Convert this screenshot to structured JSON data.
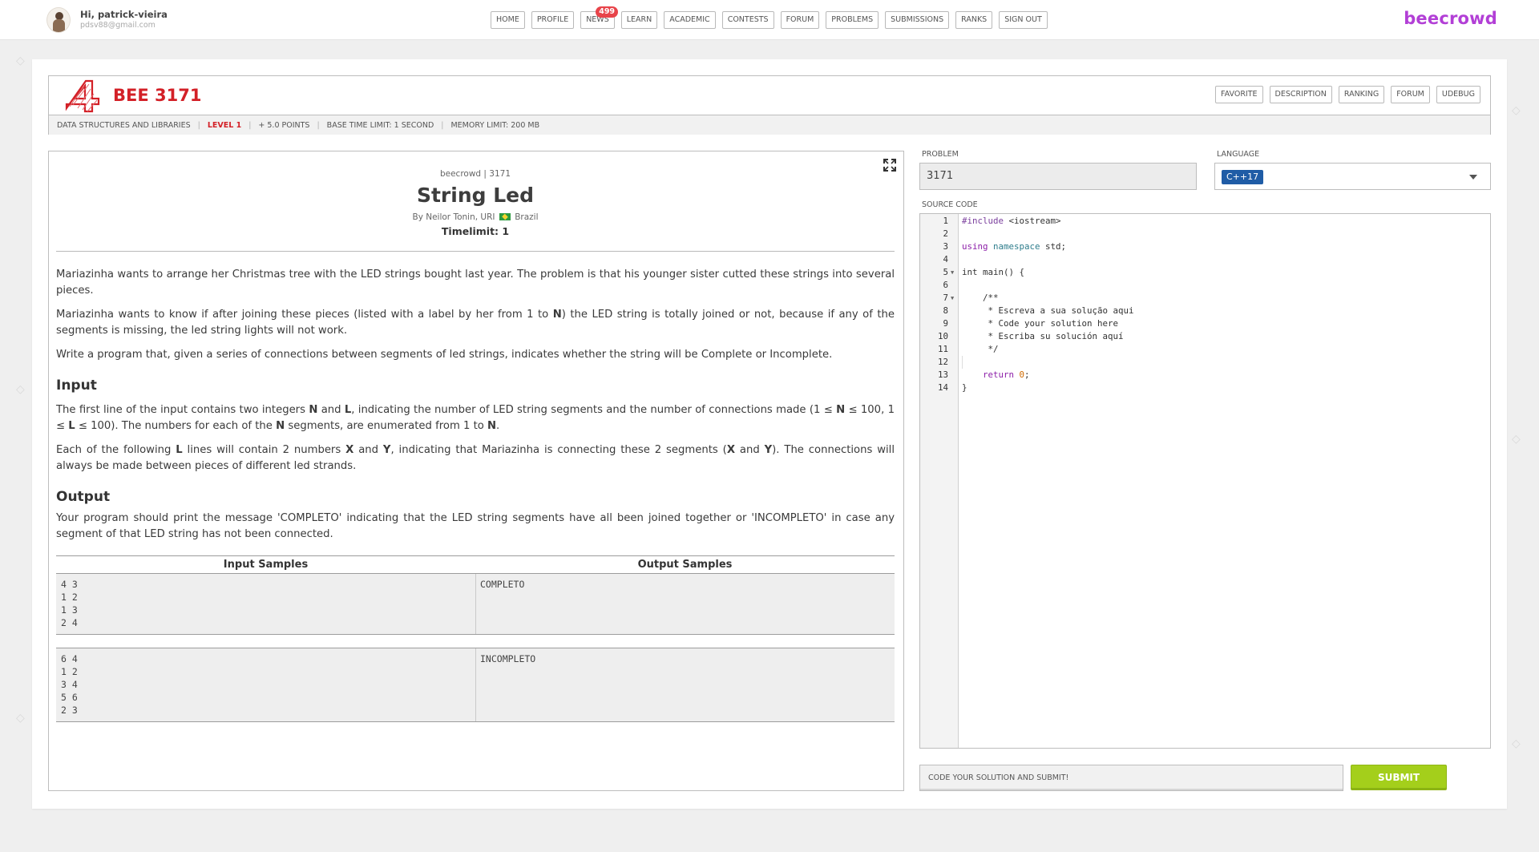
{
  "user": {
    "greeting_prefix": "Hi,",
    "name": "patrick-vieira",
    "email": "pdsv88@gmail.com"
  },
  "nav": [
    {
      "label": "HOME"
    },
    {
      "label": "PROFILE"
    },
    {
      "label": "NEWS",
      "badge": "499"
    },
    {
      "label": "LEARN"
    },
    {
      "label": "ACADEMIC"
    },
    {
      "label": "CONTESTS"
    },
    {
      "label": "FORUM"
    },
    {
      "label": "PROBLEMS"
    },
    {
      "label": "SUBMISSIONS"
    },
    {
      "label": "RANKS"
    },
    {
      "label": "SIGN OUT"
    }
  ],
  "brand": "beecrowd",
  "problem_header": {
    "code": "BEE 3171",
    "tabs": [
      "FAVORITE",
      "DESCRIPTION",
      "RANKING",
      "FORUM",
      "UDEBUG"
    ],
    "meta": {
      "category": "DATA STRUCTURES AND LIBRARIES",
      "level": "LEVEL 1",
      "points": "+ 5.0 POINTS",
      "time_limit": "BASE TIME LIMIT: 1 SECOND",
      "memory_limit": "MEMORY LIMIT: 200 MB"
    },
    "accent_color": "#d32027"
  },
  "description": {
    "source": "beecrowd | 3171",
    "title": "String Led",
    "author_prefix": "By Neilor Tonin, URI",
    "country": "Brazil",
    "timelimit": "Timelimit: 1",
    "p1": "Mariazinha wants to arrange her Christmas tree with the LED strings bought last year. The problem is that his younger sister cutted these strings into several pieces.",
    "p2_a": "Mariazinha wants to know if after joining these pieces (listed with a label by her from 1 to ",
    "p2_b": "N",
    "p2_c": ") the LED string is totally joined or not, because if any of the segments is missing, the led string lights will not work.",
    "p3": "Write a program that, given a series of connections between segments of led strings, indicates whether the string will be Complete or Incomplete.",
    "input_heading": "Input",
    "input_p1_a": "The first line of the input contains two integers ",
    "input_p1_b": "N",
    "input_p1_c": " and ",
    "input_p1_d": "L",
    "input_p1_e": ", indicating the number of LED string segments and the number of connections made (1 ≤ ",
    "input_p1_f": "N",
    "input_p1_g": " ≤ 100, 1 ≤ ",
    "input_p1_h": "L",
    "input_p1_i": " ≤ 100). The numbers for each of the ",
    "input_p1_j": "N",
    "input_p1_k": " segments, are enumerated from 1 to ",
    "input_p1_l": "N",
    "input_p1_m": ".",
    "input_p2_a": "Each of the following ",
    "input_p2_b": "L",
    "input_p2_c": " lines will contain 2 numbers ",
    "input_p2_d": "X",
    "input_p2_e": " and ",
    "input_p2_f": "Y",
    "input_p2_g": ", indicating that Mariazinha is connecting these 2 segments (",
    "input_p2_h": "X",
    "input_p2_i": " and ",
    "input_p2_j": "Y",
    "input_p2_k": "). The connections will always be made between pieces of different led strands.",
    "output_heading": "Output",
    "output_p1": "Your program should print the message 'COMPLETO' indicating that the LED string segments have all been joined together or 'INCOMPLETO' in case any segment of that LED string has not been connected.",
    "samples_input_label": "Input Samples",
    "samples_output_label": "Output Samples",
    "sample1_input": "4 3\n1 2\n1 3\n2 4",
    "sample1_output": "COMPLETO",
    "sample2_input": "6 4\n1 2\n3 4\n5 6\n2 3",
    "sample2_output": "INCOMPLETO"
  },
  "editor_panel": {
    "problem_label": "PROBLEM",
    "problem_value": "3171",
    "language_label": "LANGUAGE",
    "language_value": "C++17",
    "source_label": "SOURCE CODE",
    "code": [
      {
        "n": "1",
        "fold": false
      },
      {
        "n": "2",
        "fold": false
      },
      {
        "n": "3",
        "fold": false
      },
      {
        "n": "4",
        "fold": false
      },
      {
        "n": "5",
        "fold": true
      },
      {
        "n": "6",
        "fold": false
      },
      {
        "n": "7",
        "fold": true
      },
      {
        "n": "8",
        "fold": false
      },
      {
        "n": "9",
        "fold": false
      },
      {
        "n": "10",
        "fold": false
      },
      {
        "n": "11",
        "fold": false
      },
      {
        "n": "12",
        "fold": false
      },
      {
        "n": "13",
        "fold": false
      },
      {
        "n": "14",
        "fold": false
      }
    ],
    "code_text": {
      "l1_pp": "#include",
      "l1_rest": " <iostream>",
      "l3_kw1": "using",
      "l3_kw2": "namespace",
      "l3_rest": " std;",
      "l5": "int main() {",
      "l7": "    /**",
      "l8": "     * Escreva a sua solução aqui",
      "l9": "     * Code your solution here",
      "l10": "     * Escriba su solución aquí",
      "l11": "     */",
      "l13_kw": "    return",
      "l13_num": "0",
      "l13_end": ";",
      "l14": "}"
    },
    "hint": "CODE YOUR SOLUTION AND SUBMIT!",
    "submit_label": "SUBMIT",
    "submit_color": "#a4cf1b"
  }
}
